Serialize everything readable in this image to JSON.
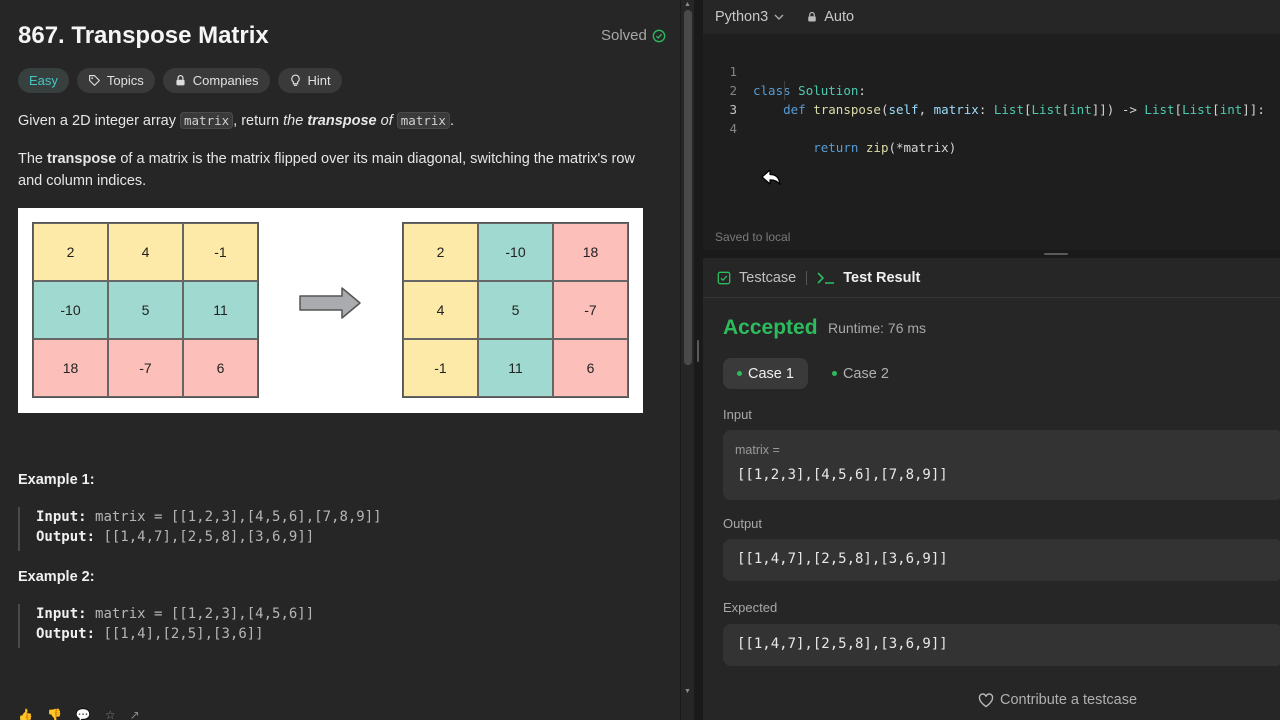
{
  "problem": {
    "title": "867. Transpose Matrix",
    "status": "Solved",
    "tags": {
      "difficulty": "Easy",
      "topics": "Topics",
      "companies": "Companies",
      "hint": "Hint"
    },
    "desc1": {
      "a": "Given a 2D integer array ",
      "code1": "matrix",
      "b": ", return ",
      "c": "the ",
      "d": "transpose",
      "e": " of ",
      "code2": "matrix",
      "f": "."
    },
    "desc2": {
      "a": "The ",
      "b": "transpose",
      "c": " of a matrix is the matrix flipped over its main diagonal, switching the matrix's row and column indices."
    },
    "figure": {
      "left": [
        "2",
        "4",
        "-1",
        "-10",
        "5",
        "11",
        "18",
        "-7",
        "6"
      ],
      "right": [
        "2",
        "-10",
        "18",
        "4",
        "5",
        "-7",
        "-1",
        "11",
        "6"
      ]
    },
    "examples": [
      {
        "title": "Example 1:",
        "input_label": "Input:",
        "input": "matrix = [[1,2,3],[4,5,6],[7,8,9]]",
        "output_label": "Output:",
        "output": "[[1,4,7],[2,5,8],[3,6,9]]"
      },
      {
        "title": "Example 2:",
        "input_label": "Input:",
        "input": "matrix = [[1,2,3],[4,5,6]]",
        "output_label": "Output:",
        "output": "[[1,4],[2,5],[3,6]]"
      }
    ]
  },
  "editor": {
    "language": "Python3",
    "mode": "Auto",
    "line_numbers": [
      "1",
      "2",
      "3",
      "4"
    ],
    "code": {
      "l1_kw": "class",
      "l1_name": "Solution",
      "l1_end": ":",
      "l2_kw": "def",
      "l2_fn": "transpose",
      "l2_open": "(",
      "l2_self": "self",
      "l2_comma": ", ",
      "l2_param": "matrix",
      "l2_colon": ": ",
      "l2_t1": "List",
      "l2_b1": "[",
      "l2_t2": "List",
      "l2_b2": "[",
      "l2_t3": "int",
      "l2_close": "]]) -> ",
      "l2_t4": "List",
      "l2_b3": "[",
      "l2_t5": "List",
      "l2_b4": "[",
      "l2_t6": "int",
      "l2_end": "]]:",
      "l3_kw": "return",
      "l3_fn": "zip",
      "l3_args": "(*matrix)"
    },
    "saved": "Saved to local"
  },
  "results": {
    "tab_testcase": "Testcase",
    "tab_result": "Test Result",
    "verdict": "Accepted",
    "runtime": "Runtime: 76 ms",
    "cases": [
      "Case 1",
      "Case 2"
    ],
    "input_label": "Input",
    "input_var": "matrix =",
    "input_value": "[[1,2,3],[4,5,6],[7,8,9]]",
    "output_label": "Output",
    "output_value": "[[1,4,7],[2,5,8],[3,6,9]]",
    "expected_label": "Expected",
    "expected_value": "[[1,4,7],[2,5,8],[3,6,9]]",
    "contribute": "Contribute a testcase"
  },
  "colors": {
    "accepted": "#2cbb5d",
    "easy": "#46c6c2",
    "cell_yellow": "#fde9a8",
    "cell_teal": "#9fd9cf",
    "cell_pink": "#fdbfb9"
  }
}
